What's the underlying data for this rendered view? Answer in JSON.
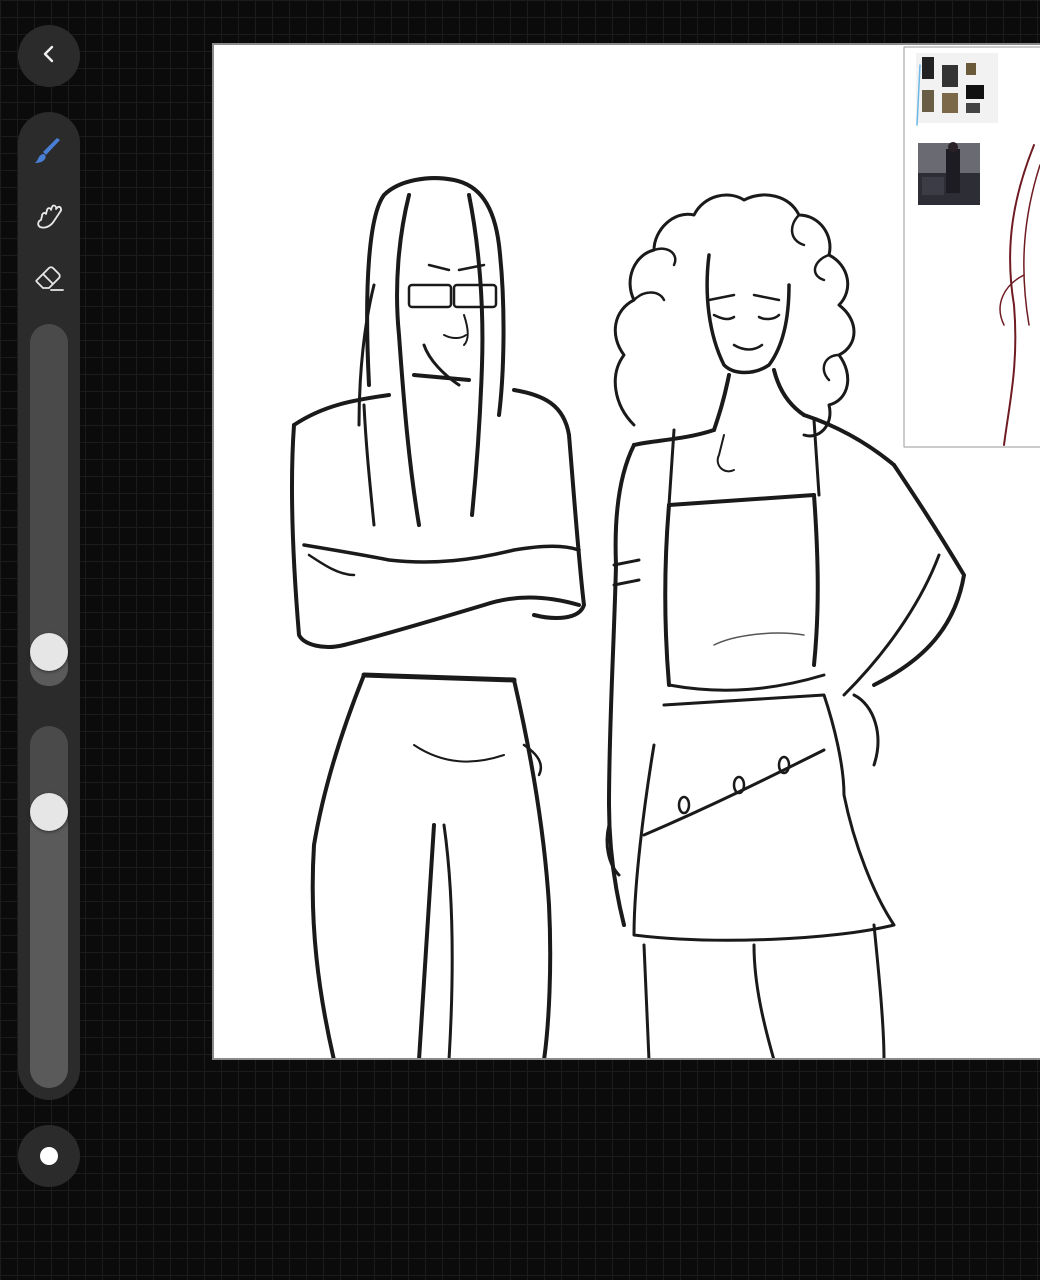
{
  "app": {
    "accent_color": "#4a7fd6",
    "background_color": "#0b0b0b",
    "canvas_color": "#ffffff",
    "grid_color": "#1c1c1c"
  },
  "navigation": {
    "back_icon": "chevron-left-icon"
  },
  "toolbar": {
    "tools": [
      {
        "name": "brush",
        "icon": "brush-icon",
        "selected": true
      },
      {
        "name": "smudge",
        "icon": "smudge-icon",
        "selected": false
      },
      {
        "name": "eraser",
        "icon": "eraser-icon",
        "selected": false
      }
    ],
    "size_slider": {
      "value_fraction": 0.1
    },
    "opacity_slider": {
      "value_fraction": 0.77
    }
  },
  "color_picker": {
    "current_color": "#ffffff"
  },
  "canvas": {
    "reference_panel": {
      "has_outfit_reference": true,
      "has_photo_reference": true
    }
  }
}
